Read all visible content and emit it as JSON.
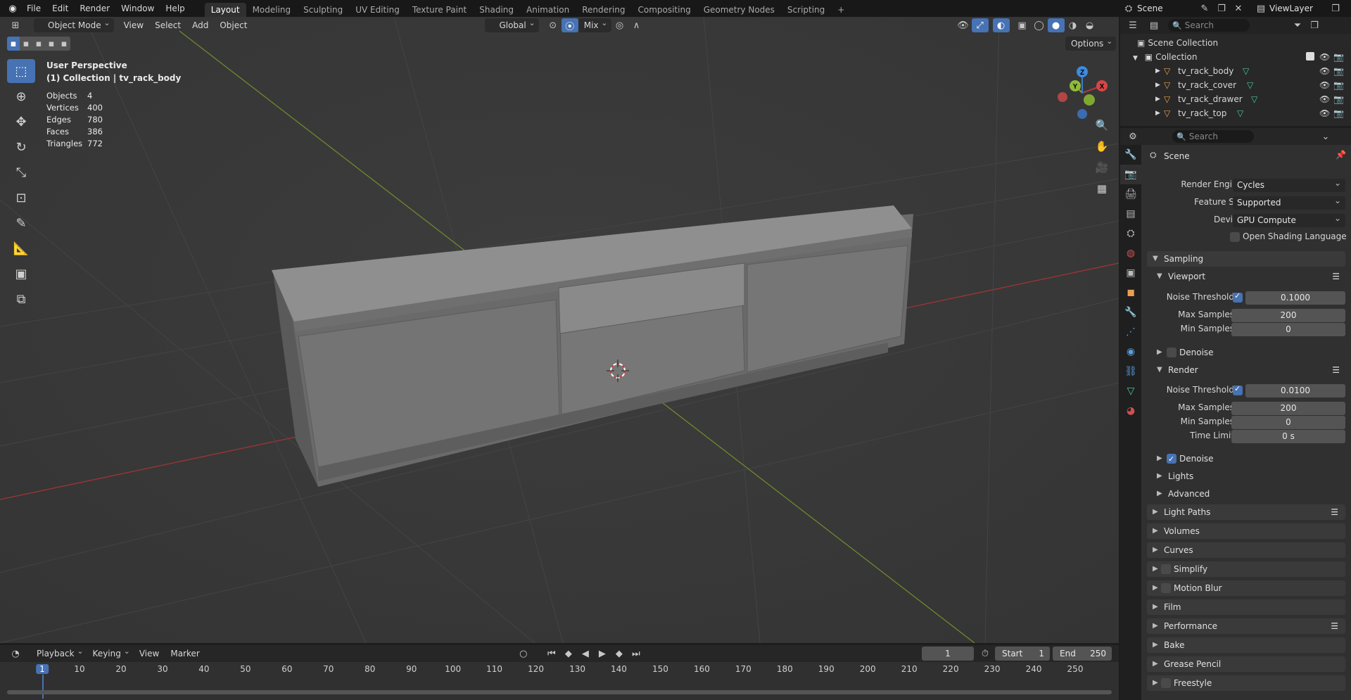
{
  "topbar": {
    "menus": [
      "File",
      "Edit",
      "Render",
      "Window",
      "Help"
    ],
    "workspaces": [
      "Layout",
      "Modeling",
      "Sculpting",
      "UV Editing",
      "Texture Paint",
      "Shading",
      "Animation",
      "Rendering",
      "Compositing",
      "Geometry Nodes",
      "Scripting"
    ],
    "active_workspace": "Layout",
    "add_workspace": "+",
    "scene_name": "Scene",
    "view_layer": "ViewLayer"
  },
  "viewport": {
    "mode": "Object Mode",
    "menus": [
      "View",
      "Select",
      "Add",
      "Object"
    ],
    "transform_orientation": "Global",
    "snap": "Mix",
    "options_label": "Options",
    "perspective_label": "User Perspective",
    "collection_label": "(1) Collection | tv_rack_body",
    "stats": [
      {
        "label": "Objects",
        "value": "4"
      },
      {
        "label": "Vertices",
        "value": "400"
      },
      {
        "label": "Edges",
        "value": "780"
      },
      {
        "label": "Faces",
        "value": "386"
      },
      {
        "label": "Triangles",
        "value": "772"
      }
    ],
    "gizmo_axes": {
      "x": "X",
      "y": "Y",
      "z": "Z"
    },
    "colors": {
      "x_axis": "#b33c3c",
      "y_axis": "#7ea23a",
      "z_axis": "#3d7dd0",
      "accent": "#4772b3"
    }
  },
  "outliner": {
    "search_placeholder": "Search",
    "root": "Scene Collection",
    "collection": "Collection",
    "objects": [
      "tv_rack_body",
      "tv_rack_cover",
      "tv_rack_drawer",
      "tv_rack_top"
    ]
  },
  "properties": {
    "search_placeholder": "Search",
    "context": "Scene",
    "render_engine_label": "Render Engine",
    "render_engine": "Cycles",
    "feature_set_label": "Feature Set",
    "feature_set": "Supported",
    "device_label": "Device",
    "device": "GPU Compute",
    "osl_label": "Open Shading Language",
    "sampling": "Sampling",
    "viewport_section": "Viewport",
    "noise_threshold_label": "Noise Threshold",
    "viewport_noise_threshold": "0.1000",
    "max_samples_label": "Max Samples",
    "viewport_max_samples": "200",
    "min_samples_label": "Min Samples",
    "viewport_min_samples": "0",
    "denoise_label": "Denoise",
    "render_section": "Render",
    "render_noise_threshold": "0.0100",
    "render_max_samples": "200",
    "render_min_samples": "0",
    "time_limit_label": "Time Limit",
    "time_limit": "0 s",
    "lights": "Lights",
    "advanced": "Advanced",
    "panels": [
      "Light Paths",
      "Volumes",
      "Curves",
      "Simplify",
      "Motion Blur",
      "Film",
      "Performance",
      "Bake",
      "Grease Pencil",
      "Freestyle"
    ]
  },
  "timeline": {
    "menus": [
      "Playback",
      "Keying",
      "View",
      "Marker"
    ],
    "current_frame": "1",
    "start_label": "Start",
    "start": "1",
    "end_label": "End",
    "end": "250",
    "ticks": [
      "1",
      "10",
      "20",
      "30",
      "40",
      "50",
      "60",
      "70",
      "80",
      "90",
      "100",
      "110",
      "120",
      "130",
      "140",
      "150",
      "160",
      "170",
      "180",
      "190",
      "200",
      "210",
      "220",
      "230",
      "240",
      "250"
    ]
  }
}
